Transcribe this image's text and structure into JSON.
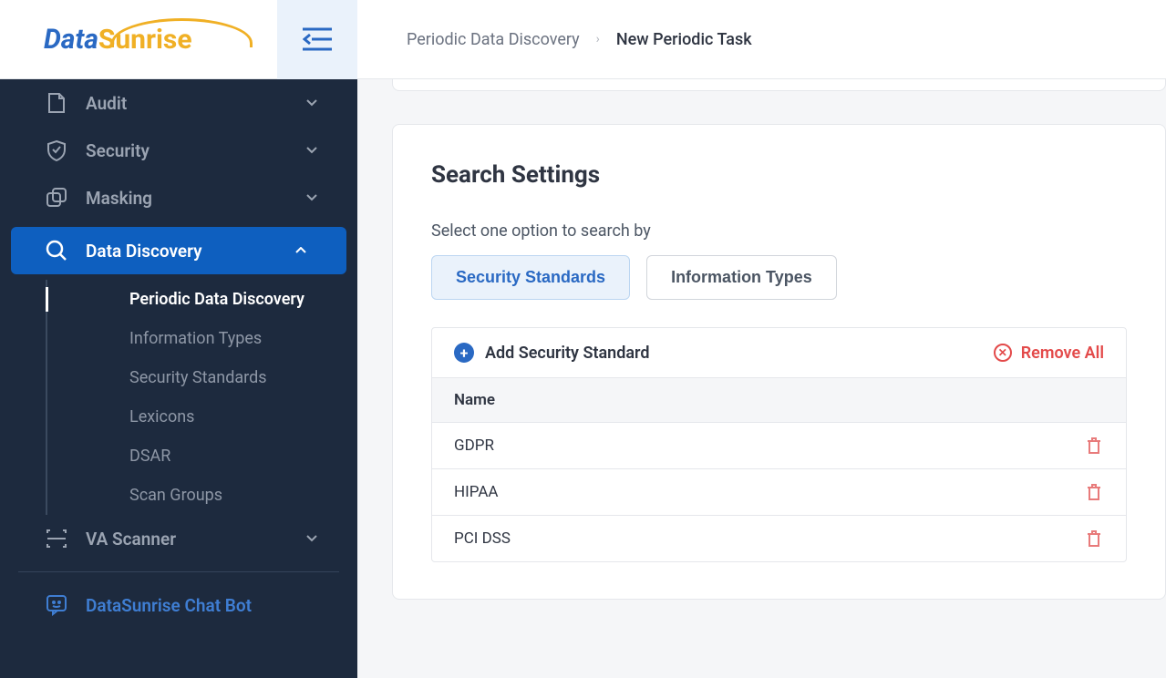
{
  "logo": {
    "part1": "Data",
    "part2": "Sunrise"
  },
  "breadcrumb": {
    "parent": "Periodic Data Discovery",
    "current": "New Periodic Task"
  },
  "sidebar": {
    "items": [
      {
        "label": "Audit"
      },
      {
        "label": "Security"
      },
      {
        "label": "Masking"
      },
      {
        "label": "Data Discovery"
      },
      {
        "label": "VA Scanner"
      }
    ],
    "subitems": [
      {
        "label": "Periodic Data Discovery"
      },
      {
        "label": "Information Types"
      },
      {
        "label": "Security Standards"
      },
      {
        "label": "Lexicons"
      },
      {
        "label": "DSAR"
      },
      {
        "label": "Scan Groups"
      }
    ],
    "chatbot": "DataSunrise Chat Bot"
  },
  "card": {
    "title": "Search Settings",
    "instruction": "Select one option to search by",
    "tabs": [
      {
        "label": "Security Standards"
      },
      {
        "label": "Information Types"
      }
    ],
    "add_label": "Add Security Standard",
    "remove_all_label": "Remove All",
    "column_header": "Name",
    "rows": [
      {
        "name": "GDPR"
      },
      {
        "name": "HIPAA"
      },
      {
        "name": "PCI DSS"
      }
    ]
  }
}
